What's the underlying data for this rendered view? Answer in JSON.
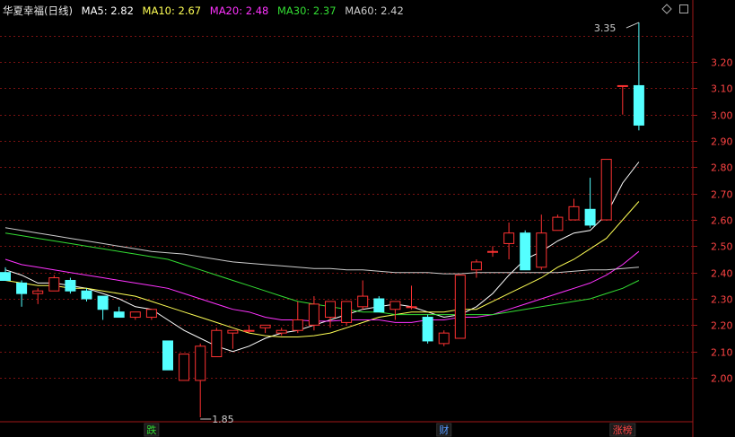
{
  "header": {
    "stock_name": "华夏幸福(日线)",
    "ma_items": [
      {
        "label": "MA5: 2.82",
        "color": "#ffffff"
      },
      {
        "label": "MA10: 2.67",
        "color": "#ffff55"
      },
      {
        "label": "MA20: 2.48",
        "color": "#ff33ff"
      },
      {
        "label": "MA30: 2.37",
        "color": "#33dd33"
      },
      {
        "label": "MA60: 2.42",
        "color": "#cccccc"
      }
    ],
    "diamond_icon": "diamond-icon",
    "square_icon": "square-icon"
  },
  "colors": {
    "up": "#ff3232",
    "down": "#54ffff",
    "grid": "#7a1212",
    "axis_text": "#ff4444",
    "axis_line": "#a01818"
  },
  "chart_data": {
    "type": "candlestick",
    "ylim": [
      1.85,
      3.4
    ],
    "y_ticks": [
      2.0,
      2.1,
      2.2,
      2.3,
      2.4,
      2.5,
      2.6,
      2.7,
      2.8,
      2.9,
      3.0,
      3.1,
      3.2
    ],
    "y_tick_labels": [
      "2.00",
      "2.10",
      "2.20",
      "2.30",
      "2.40",
      "2.50",
      "2.60",
      "2.70",
      "2.80",
      "2.90",
      "3.00",
      "3.10",
      "3.20"
    ],
    "candles": [
      {
        "o": 2.4,
        "h": 2.42,
        "l": 2.37,
        "c": 2.37
      },
      {
        "o": 2.36,
        "h": 2.37,
        "l": 2.27,
        "c": 2.32
      },
      {
        "o": 2.32,
        "h": 2.34,
        "l": 2.28,
        "c": 2.33
      },
      {
        "o": 2.33,
        "h": 2.39,
        "l": 2.33,
        "c": 2.38
      },
      {
        "o": 2.37,
        "h": 2.38,
        "l": 2.32,
        "c": 2.33
      },
      {
        "o": 2.33,
        "h": 2.34,
        "l": 2.29,
        "c": 2.3
      },
      {
        "o": 2.31,
        "h": 2.31,
        "l": 2.22,
        "c": 2.26
      },
      {
        "o": 2.25,
        "h": 2.27,
        "l": 2.23,
        "c": 2.23
      },
      {
        "o": 2.23,
        "h": 2.25,
        "l": 2.22,
        "c": 2.25
      },
      {
        "o": 2.23,
        "h": 2.26,
        "l": 2.22,
        "c": 2.26
      },
      {
        "o": 2.14,
        "h": 2.14,
        "l": 2.03,
        "c": 2.03
      },
      {
        "o": 1.99,
        "h": 2.09,
        "l": 1.99,
        "c": 2.09
      },
      {
        "o": 1.99,
        "h": 2.13,
        "l": 1.85,
        "c": 2.12
      },
      {
        "o": 2.08,
        "h": 2.19,
        "l": 2.08,
        "c": 2.18
      },
      {
        "o": 2.17,
        "h": 2.18,
        "l": 2.11,
        "c": 2.18
      },
      {
        "o": 2.18,
        "h": 2.2,
        "l": 2.17,
        "c": 2.18
      },
      {
        "o": 2.19,
        "h": 2.2,
        "l": 2.17,
        "c": 2.2
      },
      {
        "o": 2.17,
        "h": 2.19,
        "l": 2.16,
        "c": 2.18
      },
      {
        "o": 2.18,
        "h": 2.29,
        "l": 2.17,
        "c": 2.22
      },
      {
        "o": 2.2,
        "h": 2.31,
        "l": 2.18,
        "c": 2.28
      },
      {
        "o": 2.23,
        "h": 2.29,
        "l": 2.19,
        "c": 2.29
      },
      {
        "o": 2.21,
        "h": 2.29,
        "l": 2.2,
        "c": 2.29
      },
      {
        "o": 2.27,
        "h": 2.37,
        "l": 2.26,
        "c": 2.31
      },
      {
        "o": 2.3,
        "h": 2.31,
        "l": 2.25,
        "c": 2.25
      },
      {
        "o": 2.26,
        "h": 2.29,
        "l": 2.22,
        "c": 2.29
      },
      {
        "o": 2.27,
        "h": 2.35,
        "l": 2.26,
        "c": 2.27
      },
      {
        "o": 2.23,
        "h": 2.24,
        "l": 2.13,
        "c": 2.14
      },
      {
        "o": 2.13,
        "h": 2.18,
        "l": 2.12,
        "c": 2.17
      },
      {
        "o": 2.15,
        "h": 2.39,
        "l": 2.15,
        "c": 2.39
      },
      {
        "o": 2.41,
        "h": 2.45,
        "l": 2.38,
        "c": 2.44
      },
      {
        "o": 2.48,
        "h": 2.5,
        "l": 2.46,
        "c": 2.48
      },
      {
        "o": 2.51,
        "h": 2.59,
        "l": 2.45,
        "c": 2.55
      },
      {
        "o": 2.55,
        "h": 2.56,
        "l": 2.41,
        "c": 2.41
      },
      {
        "o": 2.42,
        "h": 2.62,
        "l": 2.41,
        "c": 2.55
      },
      {
        "o": 2.56,
        "h": 2.62,
        "l": 2.56,
        "c": 2.61
      },
      {
        "o": 2.6,
        "h": 2.68,
        "l": 2.6,
        "c": 2.65
      },
      {
        "o": 2.64,
        "h": 2.76,
        "l": 2.57,
        "c": 2.58
      },
      {
        "o": 2.6,
        "h": 2.83,
        "l": 2.6,
        "c": 2.83
      },
      {
        "o": 3.11,
        "h": 3.11,
        "l": 3.0,
        "c": 3.11
      },
      {
        "o": 3.11,
        "h": 3.35,
        "l": 2.94,
        "c": 2.96
      }
    ],
    "ma_lines": [
      {
        "name": "MA5",
        "color": "#ffffff",
        "values": [
          2.41,
          2.39,
          2.36,
          2.36,
          2.35,
          2.34,
          2.32,
          2.3,
          2.27,
          2.26,
          2.22,
          2.18,
          2.15,
          2.12,
          2.1,
          2.12,
          2.15,
          2.17,
          2.18,
          2.2,
          2.22,
          2.24,
          2.26,
          2.27,
          2.28,
          2.27,
          2.25,
          2.23,
          2.24,
          2.27,
          2.32,
          2.39,
          2.45,
          2.48,
          2.52,
          2.55,
          2.56,
          2.62,
          2.74,
          2.82
        ]
      },
      {
        "name": "MA10",
        "color": "#ffff55",
        "values": [
          2.37,
          2.36,
          2.35,
          2.35,
          2.34,
          2.34,
          2.33,
          2.32,
          2.31,
          2.29,
          2.27,
          2.25,
          2.23,
          2.21,
          2.19,
          2.17,
          2.16,
          2.155,
          2.155,
          2.16,
          2.17,
          2.19,
          2.21,
          2.23,
          2.24,
          2.25,
          2.25,
          2.25,
          2.26,
          2.26,
          2.29,
          2.32,
          2.35,
          2.38,
          2.42,
          2.45,
          2.49,
          2.53,
          2.6,
          2.67
        ]
      },
      {
        "name": "MA20",
        "color": "#ff33ff",
        "values": [
          2.45,
          2.43,
          2.42,
          2.41,
          2.4,
          2.39,
          2.38,
          2.37,
          2.36,
          2.35,
          2.34,
          2.32,
          2.3,
          2.28,
          2.26,
          2.25,
          2.23,
          2.22,
          2.22,
          2.215,
          2.215,
          2.22,
          2.22,
          2.22,
          2.21,
          2.21,
          2.22,
          2.22,
          2.23,
          2.23,
          2.24,
          2.26,
          2.28,
          2.3,
          2.32,
          2.34,
          2.36,
          2.39,
          2.43,
          2.48
        ]
      },
      {
        "name": "MA30",
        "color": "#33dd33",
        "values": [
          2.55,
          2.54,
          2.53,
          2.52,
          2.51,
          2.5,
          2.49,
          2.48,
          2.47,
          2.46,
          2.45,
          2.43,
          2.41,
          2.39,
          2.37,
          2.35,
          2.33,
          2.31,
          2.29,
          2.28,
          2.27,
          2.26,
          2.25,
          2.25,
          2.24,
          2.24,
          2.24,
          2.24,
          2.24,
          2.24,
          2.24,
          2.25,
          2.26,
          2.27,
          2.28,
          2.29,
          2.3,
          2.32,
          2.34,
          2.37
        ]
      },
      {
        "name": "MA60",
        "color": "#cccccc",
        "values": [
          2.57,
          2.56,
          2.55,
          2.54,
          2.53,
          2.52,
          2.51,
          2.5,
          2.49,
          2.48,
          2.475,
          2.47,
          2.46,
          2.45,
          2.44,
          2.435,
          2.43,
          2.425,
          2.42,
          2.415,
          2.415,
          2.41,
          2.41,
          2.405,
          2.4,
          2.4,
          2.4,
          2.395,
          2.395,
          2.4,
          2.4,
          2.4,
          2.4,
          2.4,
          2.4,
          2.405,
          2.41,
          2.41,
          2.415,
          2.42
        ]
      }
    ],
    "annotations": [
      {
        "text": "3.35",
        "candle": 39,
        "price": 3.35,
        "side": "left"
      },
      {
        "text": "1.85",
        "candle": 12,
        "price": 1.85,
        "side": "right"
      }
    ],
    "markers": [
      {
        "text": "跌",
        "candle": 9,
        "color": "#33dd33"
      },
      {
        "text": "财",
        "candle": 27,
        "color": "#5599ff"
      },
      {
        "text": "涨榜",
        "candle": 38,
        "color": "#ff4444"
      }
    ]
  }
}
